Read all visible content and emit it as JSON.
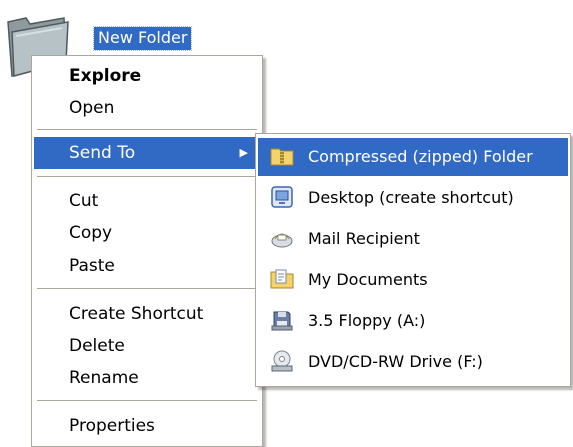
{
  "desktop": {
    "folder_icon": "folder-icon",
    "folder_label": "New Folder"
  },
  "context_menu": {
    "items": [
      {
        "label": "Explore",
        "bold": true
      },
      {
        "label": "Open"
      },
      {
        "label": "Send To",
        "highlighted": true,
        "has_submenu": true
      },
      {
        "label": "Cut"
      },
      {
        "label": "Copy"
      },
      {
        "label": "Paste"
      },
      {
        "label": "Create Shortcut"
      },
      {
        "label": "Delete"
      },
      {
        "label": "Rename"
      },
      {
        "label": "Properties"
      }
    ],
    "submenu_arrow": "▶"
  },
  "send_to_submenu": {
    "items": [
      {
        "label": "Compressed (zipped) Folder",
        "icon": "zip-folder-icon",
        "highlighted": true
      },
      {
        "label": "Desktop (create shortcut)",
        "icon": "desktop-icon"
      },
      {
        "label": "Mail Recipient",
        "icon": "mail-icon"
      },
      {
        "label": "My Documents",
        "icon": "documents-icon"
      },
      {
        "label": "3.5 Floppy (A:)",
        "icon": "floppy-icon"
      },
      {
        "label": "DVD/CD-RW Drive (F:)",
        "icon": "dvd-drive-icon"
      }
    ]
  },
  "colors": {
    "highlight": "#316ac5",
    "menu_border": "#aca899"
  }
}
